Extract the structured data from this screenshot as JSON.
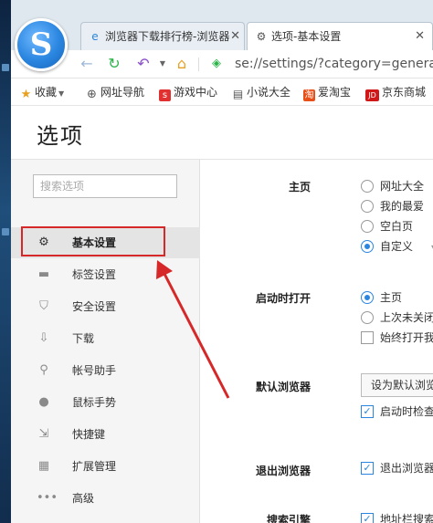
{
  "tabs": [
    {
      "label": "浏览器下载排行榜-浏览器",
      "icon": "ie-icon"
    },
    {
      "label": "选项-基本设置",
      "icon": "gear-icon"
    }
  ],
  "address": {
    "url": "se://settings/?category=general"
  },
  "bookmarks": [
    {
      "label": "收藏",
      "icon": "star-icon"
    },
    {
      "label": "网址导航",
      "icon": "globe-icon"
    },
    {
      "label": "游戏中心",
      "icon": "game-icon"
    },
    {
      "label": "小说大全",
      "icon": "book-icon"
    },
    {
      "label": "爱淘宝",
      "icon": "taobao-icon"
    },
    {
      "label": "京东商城",
      "icon": "jd-icon"
    }
  ],
  "page": {
    "title": "选项"
  },
  "sidebar": {
    "search_placeholder": "搜索选项",
    "items": [
      {
        "label": "基本设置",
        "icon": "gear-icon",
        "active": true
      },
      {
        "label": "标签设置",
        "icon": "tab-icon"
      },
      {
        "label": "安全设置",
        "icon": "shield-icon"
      },
      {
        "label": "下载",
        "icon": "download-icon"
      },
      {
        "label": "帐号助手",
        "icon": "key-icon"
      },
      {
        "label": "鼠标手势",
        "icon": "mouse-icon"
      },
      {
        "label": "快捷键",
        "icon": "shortcut-icon"
      },
      {
        "label": "扩展管理",
        "icon": "extensions-icon"
      },
      {
        "label": "高级",
        "icon": "more-icon"
      }
    ]
  },
  "main": {
    "homepage": {
      "label": "主页",
      "options": [
        "网址大全",
        "我的最爱",
        "空白页",
        "自定义"
      ],
      "selected": "自定义"
    },
    "startup": {
      "label": "启动时打开",
      "options": [
        "主页",
        "上次未关闭的页面"
      ],
      "selected": "主页",
      "checkbox": "始终打开我的主页"
    },
    "default_browser": {
      "label": "默认浏览器",
      "button": "设为默认浏览器",
      "checkbox": "启动时检查是否为默认浏览器"
    },
    "exit": {
      "label": "退出浏览器",
      "checkbox": "退出浏览器时提醒"
    },
    "search_engine": {
      "label": "搜索引擎",
      "checkbox": "地址栏搜索"
    }
  },
  "colors": {
    "accent": "#2a86e0",
    "annotation": "#d62828"
  }
}
